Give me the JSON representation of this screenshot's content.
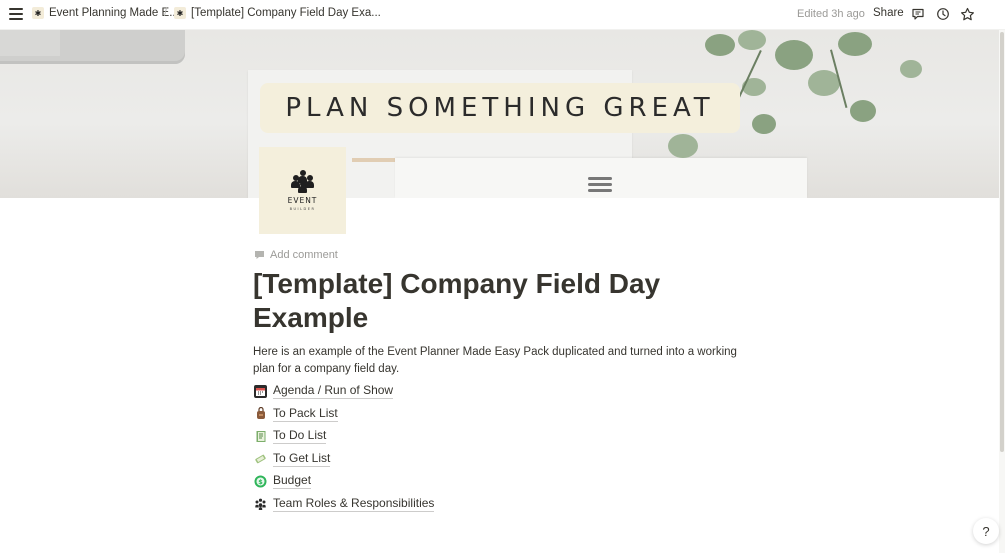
{
  "topbar": {
    "breadcrumbs": [
      {
        "label": "Event Planning Made E..."
      },
      {
        "label": "[Template] Company Field Day Exa..."
      }
    ],
    "separator": "/",
    "edited": "Edited 3h ago",
    "share_label": "Share",
    "icons": [
      "menu-icon",
      "comment-icon",
      "history-icon",
      "star-icon"
    ]
  },
  "cover": {
    "banner_text": "PLAN SOMETHING GREAT"
  },
  "page_icon": {
    "logo_title": "EVENT",
    "logo_subtitle": "BUILDER"
  },
  "page": {
    "add_comment": "Add comment",
    "title": "[Template] Company Field Day Example",
    "description": "Here is an example of the Event Planner Made Easy Pack duplicated and turned into a working plan for a company field day.",
    "links": [
      {
        "label": "Agenda / Run of Show",
        "icon": "calendar-icon"
      },
      {
        "label": "To Pack List",
        "icon": "bag-icon"
      },
      {
        "label": "To Do List",
        "icon": "notebook-icon"
      },
      {
        "label": "To Get List",
        "icon": "ticket-icon"
      },
      {
        "label": "Budget",
        "icon": "money-icon"
      },
      {
        "label": "Team Roles & Responsibilities",
        "icon": "people-icon"
      }
    ]
  },
  "help": {
    "label": "?"
  }
}
